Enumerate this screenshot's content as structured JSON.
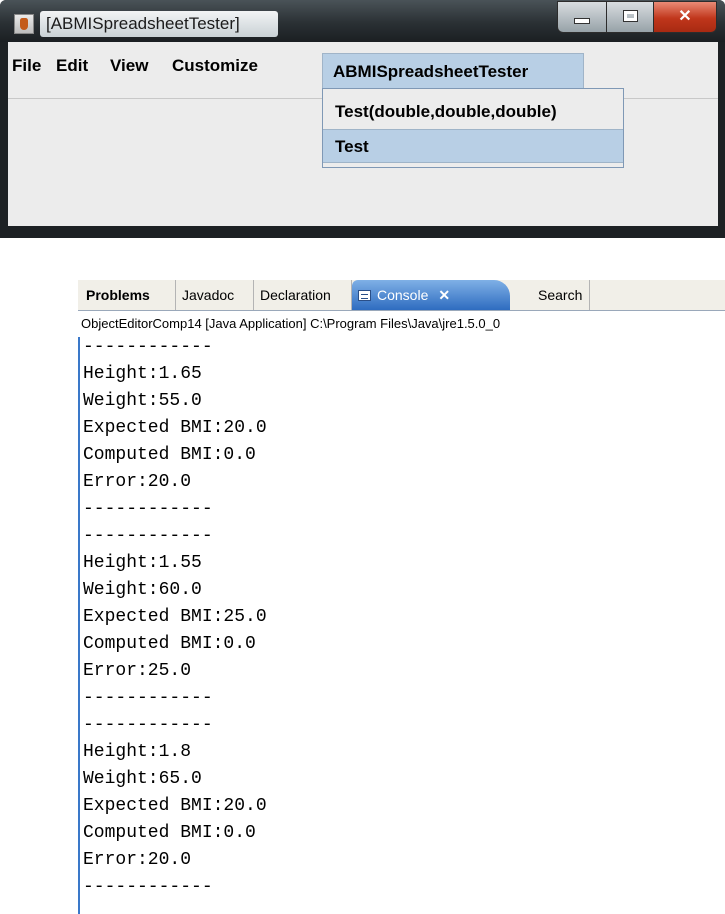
{
  "window": {
    "title": "[ABMISpreadsheetTester]",
    "menus": [
      "File",
      "Edit",
      "View",
      "Customize",
      "ABMISpreadsheetTester"
    ],
    "dropdown_items": [
      "Test(double,double,double)",
      "Test"
    ]
  },
  "console": {
    "tabs": [
      "Problems",
      "Javadoc",
      "Declaration",
      "Console",
      "Search"
    ],
    "active_tab": "Console",
    "info": "ObjectEditorComp14 [Java Application] C:\\Program Files\\Java\\jre1.5.0_0",
    "lines": [
      "------------",
      "Height:1.65",
      "Weight:55.0",
      "Expected BMI:20.0",
      "Computed BMI:0.0",
      "Error:20.0",
      "------------",
      "------------",
      "Height:1.55",
      "Weight:60.0",
      "Expected BMI:25.0",
      "Computed BMI:0.0",
      "Error:25.0",
      "------------",
      "------------",
      "Height:1.8",
      "Weight:65.0",
      "Expected BMI:20.0",
      "Computed BMI:0.0",
      "Error:20.0",
      "------------"
    ]
  }
}
